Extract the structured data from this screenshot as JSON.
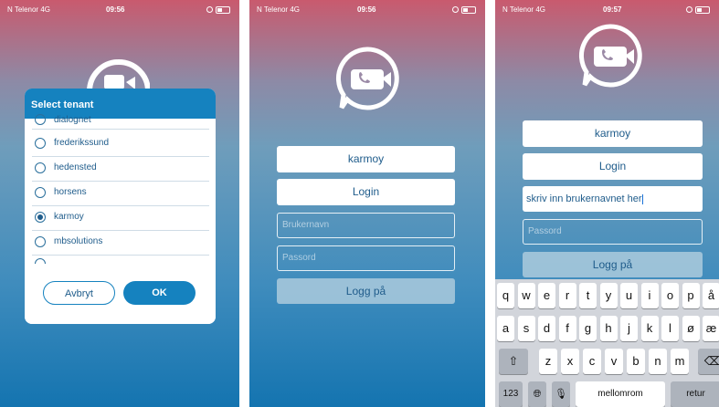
{
  "screen1": {
    "status": {
      "carrier": "N Telenor  4G",
      "time": "09:56"
    },
    "dialog": {
      "title": "Select tenant",
      "options": [
        "dialognet",
        "frederikssund",
        "hedensted",
        "horsens",
        "karmoy",
        "mbsolutions"
      ],
      "selected": "karmoy",
      "cancel_label": "Avbryt",
      "ok_label": "OK"
    }
  },
  "screen2": {
    "status": {
      "carrier": "N Telenor  4G",
      "time": "09:56"
    },
    "tenant_label": "karmoy",
    "login_label": "Login",
    "username_placeholder": "Brukernavn",
    "password_placeholder": "Passord",
    "submit_label": "Logg på"
  },
  "screen3": {
    "status": {
      "carrier": "N Telenor  4G",
      "time": "09:57"
    },
    "tenant_label": "karmoy",
    "login_label": "Login",
    "username_value": "skriv inn brukernavnet her",
    "password_placeholder": "Passord",
    "submit_label": "Logg på",
    "keyboard": {
      "row1": [
        "q",
        "w",
        "e",
        "r",
        "t",
        "y",
        "u",
        "i",
        "o",
        "p",
        "å"
      ],
      "row2": [
        "a",
        "s",
        "d",
        "f",
        "g",
        "h",
        "j",
        "k",
        "l",
        "ø",
        "æ"
      ],
      "row3": [
        "z",
        "x",
        "c",
        "v",
        "b",
        "n",
        "m"
      ],
      "numbers_label": "123",
      "space_label": "mellomrom",
      "return_label": "retur"
    }
  },
  "colors": {
    "accent": "#1582bf",
    "text_blue": "#1f5c8b"
  }
}
